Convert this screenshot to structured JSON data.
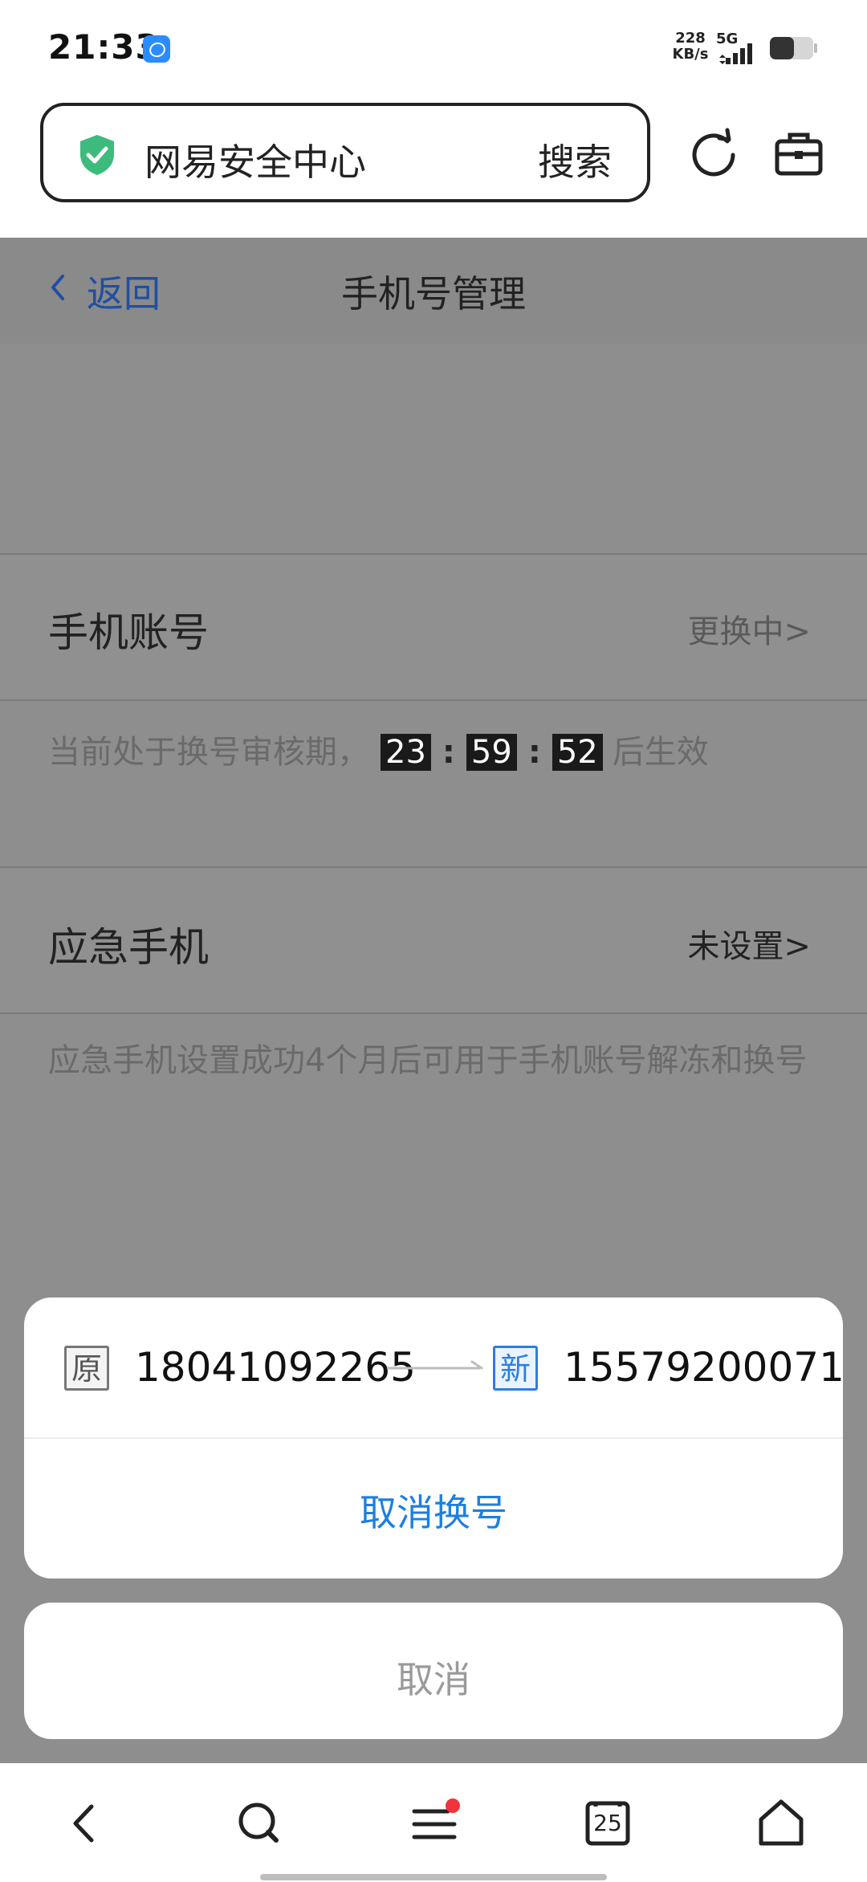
{
  "status_bar": {
    "time": "21:33",
    "net_speed_value": "228",
    "net_speed_unit": "KB/s",
    "network_type": "5G"
  },
  "browser": {
    "search_text": "网易安全中心",
    "search_button": "搜索"
  },
  "header": {
    "back_label": "返回",
    "title": "手机号管理"
  },
  "phone_account": {
    "title": "手机账号",
    "status": "更换中>",
    "notice_prefix": "当前处于换号审核期，",
    "countdown_hours": "23",
    "countdown_minutes": "59",
    "countdown_seconds": "52",
    "colon": ":",
    "notice_suffix": "后生效"
  },
  "emergency_phone": {
    "title": "应急手机",
    "status": "未设置>",
    "description": "应急手机设置成功4个月后可用于手机账号解冻和换号"
  },
  "sheet": {
    "original_tag": "原",
    "original_number": "18041092265",
    "new_tag": "新",
    "new_number": "15579200071",
    "cancel_change_label": "取消换号",
    "cancel_label": "取消"
  },
  "bottom_nav": {
    "tabs_count": "25",
    "menu_has_badge": true,
    "badge_color": "#f0333c"
  },
  "colors": {
    "link_blue": "#1d7fe0",
    "back_blue": "#1f4fa3",
    "shield_green": "#3dbb7c",
    "overlay_gray": "#8e8e8e"
  }
}
